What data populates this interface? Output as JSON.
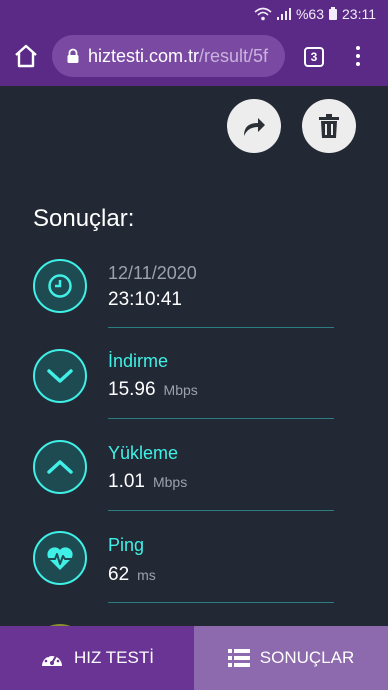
{
  "status_bar": {
    "battery_text": "%63",
    "time": "23:11",
    "icons": [
      "wifi-icon",
      "signal-icon",
      "battery-icon"
    ]
  },
  "browser": {
    "url_host": "hiztesti.com.tr",
    "url_path": "/result/5f",
    "tab_count": "3",
    "icons": [
      "home-icon",
      "lock-icon",
      "menu-icon"
    ]
  },
  "actions": {
    "icons": [
      "share-icon",
      "trash-icon"
    ]
  },
  "results": {
    "title": "Sonuçlar:",
    "date_row": {
      "date": "12/11/2020",
      "time": "23:10:41",
      "icon": "clock-icon"
    },
    "download": {
      "label": "İndirme",
      "value": "15.96",
      "unit": "Mbps",
      "icon": "chevron-down-icon"
    },
    "upload": {
      "label": "Yükleme",
      "value": "1.01",
      "unit": "Mbps",
      "icon": "chevron-up-icon"
    },
    "ping": {
      "label": "Ping",
      "value": "62",
      "unit": "ms",
      "icon": "heartbeat-icon"
    }
  },
  "bottom_nav": {
    "speed_test": {
      "label": "HIZ TESTİ",
      "icon": "speedometer-icon"
    },
    "results": {
      "label": "SONUÇLAR",
      "icon": "list-icon"
    }
  },
  "colors": {
    "brand_purple": "#5b2a86",
    "background": "#222934",
    "accent_cyan": "#3ff0e6",
    "nav_active": "#8d69ad"
  }
}
